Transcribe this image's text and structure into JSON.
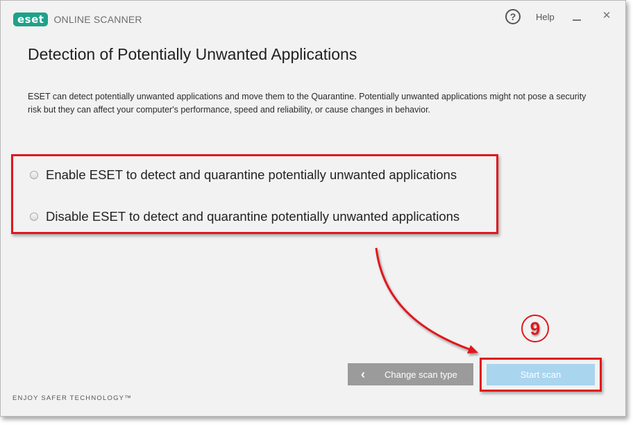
{
  "header": {
    "logo_text": "eset",
    "app_name": "ONLINE SCANNER",
    "help_icon_glyph": "?",
    "help_label": "Help",
    "minimize_icon": "minimize-icon",
    "close_icon_glyph": "✕"
  },
  "main": {
    "title": "Detection of Potentially Unwanted Applications",
    "description": "ESET can detect potentially unwanted applications and move them to the Quarantine. Potentially unwanted applications might not pose a security risk but they can affect your computer's performance, speed and reliability, or cause changes in behavior.",
    "options": [
      {
        "label": "Enable ESET to detect and quarantine potentially unwanted applications",
        "selected": false
      },
      {
        "label": "Disable ESET to detect and quarantine potentially unwanted applications",
        "selected": false
      }
    ]
  },
  "buttons": {
    "back_icon_glyph": "‹",
    "back_label": "Change scan type",
    "start_label": "Start scan"
  },
  "annotation": {
    "step_number": "9"
  },
  "footer": {
    "tagline": "ENJOY SAFER TECHNOLOGY™"
  },
  "colors": {
    "brand": "#1fa18a",
    "highlight": "#e0171d",
    "start_button": "#a9d5ef",
    "back_button": "#9b9b9b"
  }
}
